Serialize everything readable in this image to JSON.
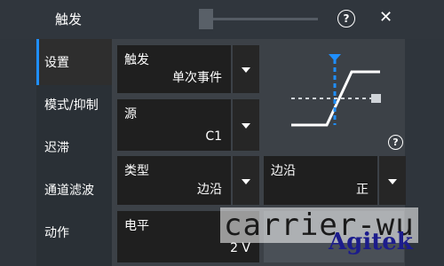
{
  "header": {
    "title": "触发",
    "help_icon": "question-circle-icon",
    "close_icon": "close-icon",
    "help_glyph": "?",
    "close_glyph": "✕"
  },
  "sidebar": {
    "items": [
      {
        "label": "设置",
        "active": true
      },
      {
        "label": "模式/抑制",
        "active": false
      },
      {
        "label": "迟滞",
        "active": false
      },
      {
        "label": "通道滤波",
        "active": false
      },
      {
        "label": "动作",
        "active": false
      }
    ]
  },
  "fields": {
    "trigger": {
      "label": "触发",
      "value": "单次事件"
    },
    "source": {
      "label": "源",
      "value": "C1"
    },
    "type": {
      "label": "类型",
      "value": "边沿"
    },
    "edge": {
      "label": "边沿",
      "value": "正"
    },
    "level": {
      "label": "电平",
      "value": "2 V"
    }
  },
  "overlay": {
    "watermark": "carrier-wu",
    "brand": "Agitek"
  },
  "colors": {
    "accent": "#1f8fff",
    "panel": "#3c4147",
    "field": "#1f1f1f"
  }
}
